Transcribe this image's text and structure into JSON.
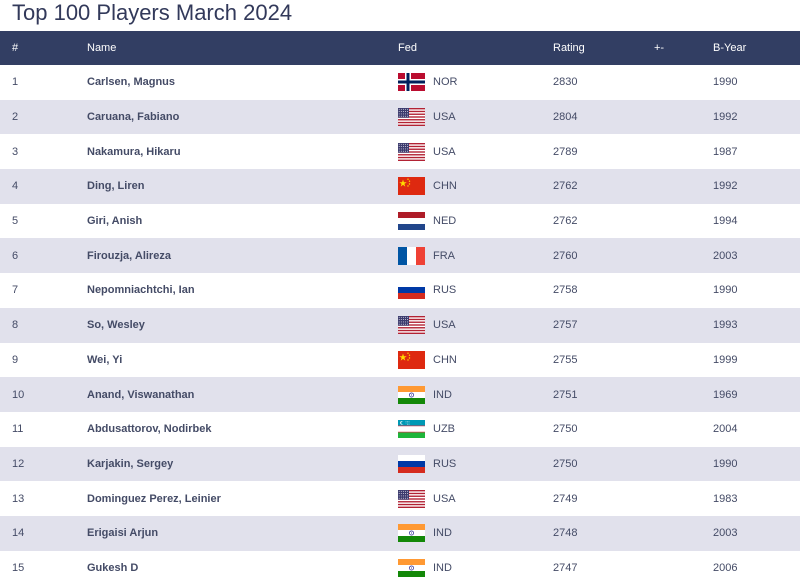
{
  "page": {
    "title": "Top 100 Players March 2024"
  },
  "table": {
    "headers": {
      "rank": "#",
      "name": "Name",
      "fed": "Fed",
      "rating": "Rating",
      "diff": "+-",
      "byear": "B-Year"
    },
    "rows": [
      {
        "rank": "1",
        "name": "Carlsen, Magnus",
        "fed": "NOR",
        "flag": "norway-flag-icon",
        "rating": "2830",
        "diff": "",
        "byear": "1990"
      },
      {
        "rank": "2",
        "name": "Caruana, Fabiano",
        "fed": "USA",
        "flag": "usa-flag-icon",
        "rating": "2804",
        "diff": "",
        "byear": "1992"
      },
      {
        "rank": "3",
        "name": "Nakamura, Hikaru",
        "fed": "USA",
        "flag": "usa-flag-icon",
        "rating": "2789",
        "diff": "",
        "byear": "1987"
      },
      {
        "rank": "4",
        "name": "Ding, Liren",
        "fed": "CHN",
        "flag": "china-flag-icon",
        "rating": "2762",
        "diff": "",
        "byear": "1992"
      },
      {
        "rank": "5",
        "name": "Giri, Anish",
        "fed": "NED",
        "flag": "netherlands-flag-icon",
        "rating": "2762",
        "diff": "",
        "byear": "1994"
      },
      {
        "rank": "6",
        "name": "Firouzja, Alireza",
        "fed": "FRA",
        "flag": "france-flag-icon",
        "rating": "2760",
        "diff": "",
        "byear": "2003"
      },
      {
        "rank": "7",
        "name": "Nepomniachtchi, Ian",
        "fed": "RUS",
        "flag": "russia-flag-icon",
        "rating": "2758",
        "diff": "",
        "byear": "1990"
      },
      {
        "rank": "8",
        "name": "So, Wesley",
        "fed": "USA",
        "flag": "usa-flag-icon",
        "rating": "2757",
        "diff": "",
        "byear": "1993"
      },
      {
        "rank": "9",
        "name": "Wei, Yi",
        "fed": "CHN",
        "flag": "china-flag-icon",
        "rating": "2755",
        "diff": "",
        "byear": "1999"
      },
      {
        "rank": "10",
        "name": "Anand, Viswanathan",
        "fed": "IND",
        "flag": "india-flag-icon",
        "rating": "2751",
        "diff": "",
        "byear": "1969"
      },
      {
        "rank": "11",
        "name": "Abdusattorov, Nodirbek",
        "fed": "UZB",
        "flag": "uzbekistan-flag-icon",
        "rating": "2750",
        "diff": "",
        "byear": "2004"
      },
      {
        "rank": "12",
        "name": "Karjakin, Sergey",
        "fed": "RUS",
        "flag": "russia-flag-icon",
        "rating": "2750",
        "diff": "",
        "byear": "1990"
      },
      {
        "rank": "13",
        "name": "Dominguez Perez, Leinier",
        "fed": "USA",
        "flag": "usa-flag-icon",
        "rating": "2749",
        "diff": "",
        "byear": "1983"
      },
      {
        "rank": "14",
        "name": "Erigaisi Arjun",
        "fed": "IND",
        "flag": "india-flag-icon",
        "rating": "2748",
        "diff": "",
        "byear": "2003"
      },
      {
        "rank": "15",
        "name": "Gukesh D",
        "fed": "IND",
        "flag": "india-flag-icon",
        "rating": "2747",
        "diff": "",
        "byear": "2006"
      }
    ]
  },
  "colors": {
    "header_bg": "#323e63",
    "row_alt_bg": "#e1e1ec",
    "text": "#444b66"
  }
}
